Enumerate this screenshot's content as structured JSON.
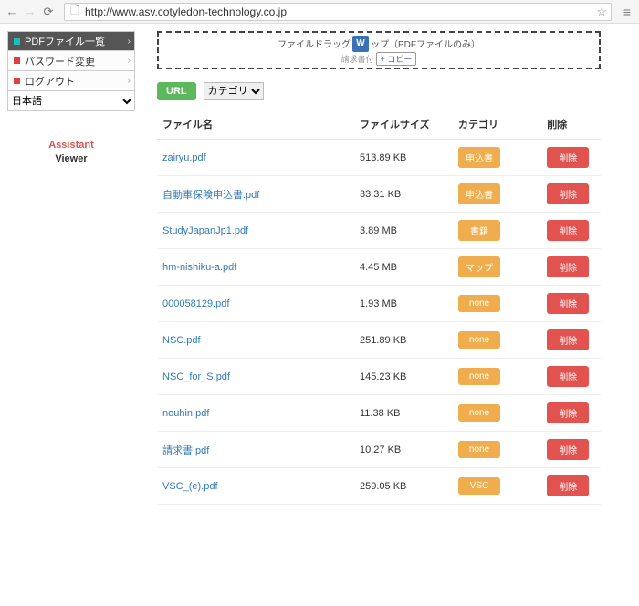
{
  "browser": {
    "url": "http://www.asv.cotyledon-technology.co.jp"
  },
  "sidebar": {
    "items": [
      {
        "label": "PDFファイル一覧",
        "active": true,
        "color": "teal"
      },
      {
        "label": "パスワード変更",
        "active": false,
        "color": "red"
      },
      {
        "label": "ログアウト",
        "active": false,
        "color": "red"
      }
    ],
    "language": "日本語"
  },
  "brand": {
    "line1": "Assistant",
    "line2": "Viewer"
  },
  "dropzone": {
    "text_left": "ファイルドラッグ",
    "text_right": "ップ（PDFファイルのみ）",
    "sub_label": "請求書付",
    "copy_label": "+ コピー"
  },
  "toolbar": {
    "url_button": "URL",
    "category_label": "カテゴリ"
  },
  "table": {
    "headers": {
      "filename": "ファイル名",
      "filesize": "ファイルサイズ",
      "category": "カテゴリ",
      "delete": "削除"
    },
    "rows": [
      {
        "filename": "zairyu.pdf",
        "filesize": "513.89 KB",
        "category": "申込書",
        "delete": "削除"
      },
      {
        "filename": "自動車保険申込書.pdf",
        "filesize": "33.31 KB",
        "category": "申込書",
        "delete": "削除"
      },
      {
        "filename": "StudyJapanJp1.pdf",
        "filesize": "3.89 MB",
        "category": "書籍",
        "delete": "削除"
      },
      {
        "filename": "hm-nishiku-a.pdf",
        "filesize": "4.45 MB",
        "category": "マップ",
        "delete": "削除"
      },
      {
        "filename": "000058129.pdf",
        "filesize": "1.93 MB",
        "category": "none",
        "delete": "削除"
      },
      {
        "filename": "NSC.pdf",
        "filesize": "251.89 KB",
        "category": "none",
        "delete": "削除"
      },
      {
        "filename": "NSC_for_S.pdf",
        "filesize": "145.23 KB",
        "category": "none",
        "delete": "削除"
      },
      {
        "filename": "nouhin.pdf",
        "filesize": "11.38 KB",
        "category": "none",
        "delete": "削除"
      },
      {
        "filename": "請求書.pdf",
        "filesize": "10.27 KB",
        "category": "none",
        "delete": "削除"
      },
      {
        "filename": "VSC_(e).pdf",
        "filesize": "259.05 KB",
        "category": "VSC",
        "delete": "削除"
      }
    ]
  }
}
